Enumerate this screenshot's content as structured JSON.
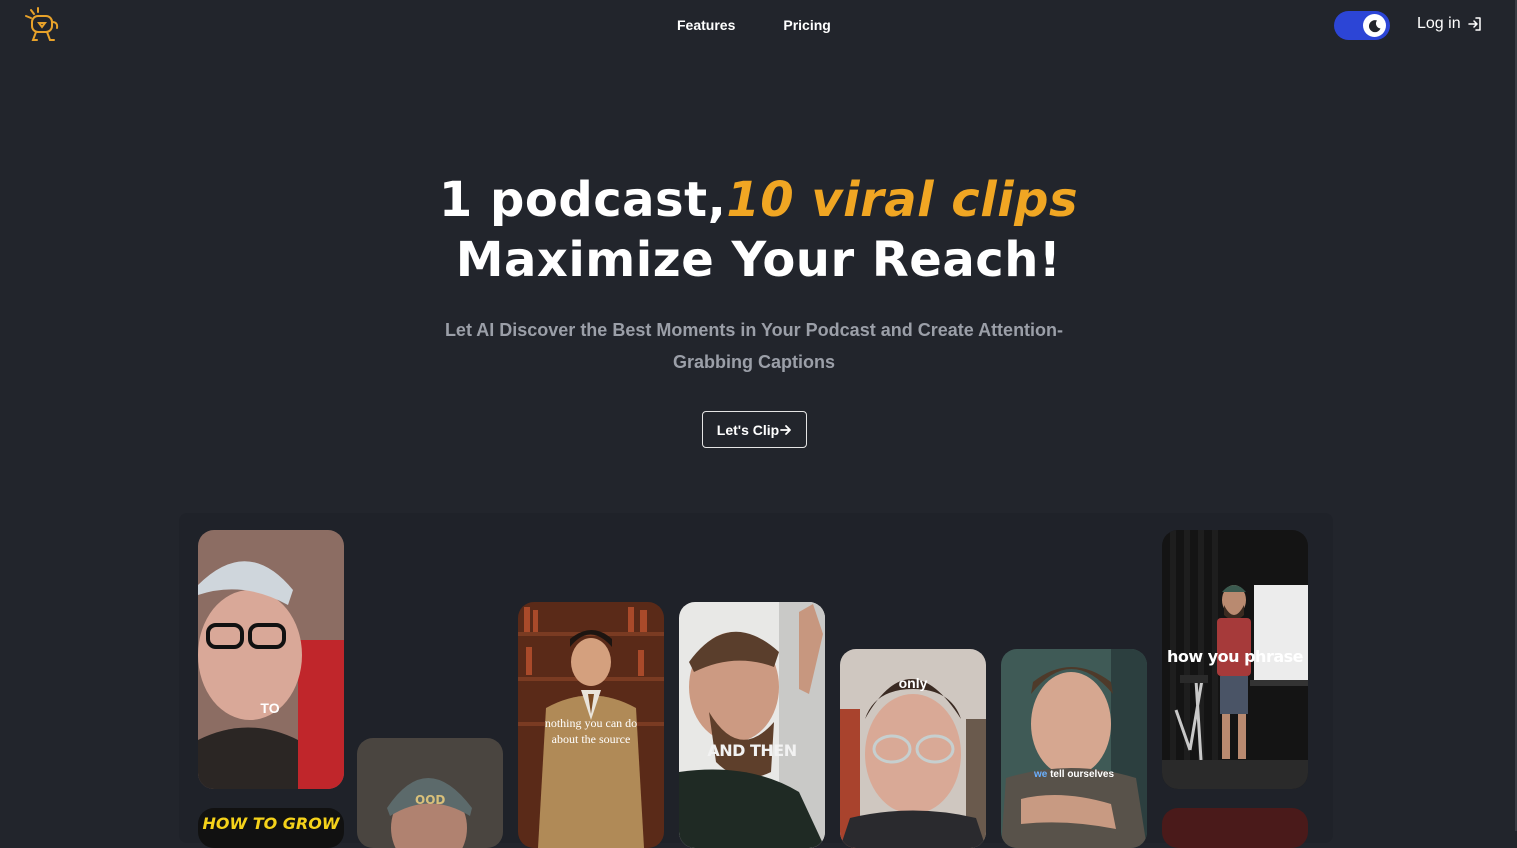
{
  "nav": {
    "logo_icon": "robot-mascot-icon",
    "links": [
      {
        "label": "Features"
      },
      {
        "label": "Pricing"
      }
    ],
    "theme_toggle_icon": "moon-icon",
    "login_label": "Log in",
    "login_icon": "login-arrow-icon"
  },
  "hero": {
    "title_part1": "1 podcast,",
    "title_accent": "10 viral clips",
    "title_line2": "Maximize Your Reach!",
    "subtitle": "Let AI Discover the Best Moments in Your Podcast and Create Attention-Grabbing Captions",
    "cta_label": "Let's Clip",
    "cta_icon": "arrow-right-icon"
  },
  "clips": [
    {
      "caption": "TO"
    },
    {
      "caption": "HOW TO GROW"
    },
    {
      "caption": ""
    },
    {
      "caption": "nothing you can do about the source"
    },
    {
      "caption": "AND THEN"
    },
    {
      "caption": "only"
    },
    {
      "caption_highlight": "we",
      "caption": "tell ourselves"
    },
    {
      "caption": "how you phrase"
    }
  ],
  "colors": {
    "background": "#22252c",
    "accent": "#f0a623",
    "toggle": "#2c45d6",
    "subtitle": "#9b9fa8"
  }
}
